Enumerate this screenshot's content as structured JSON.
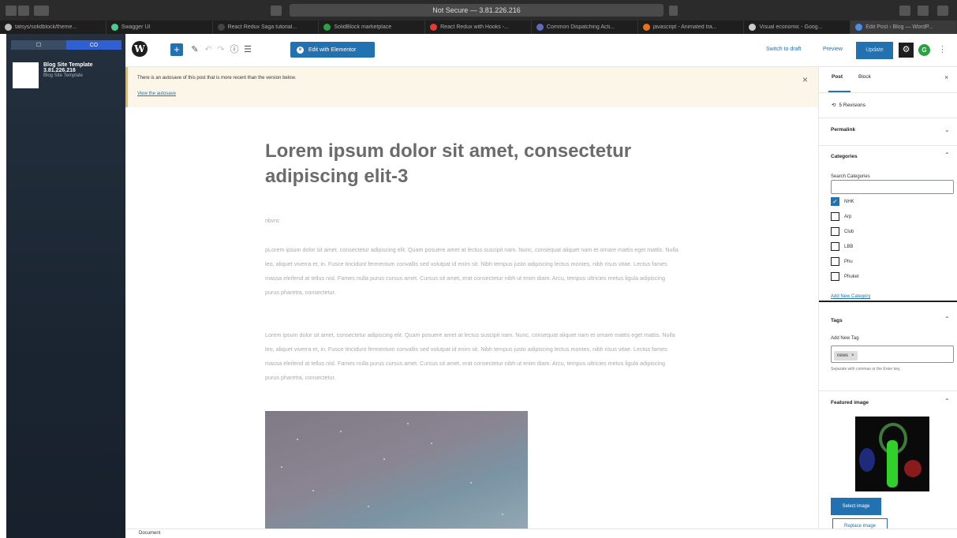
{
  "browser": {
    "url": "Not Secure — 3.81.226.216",
    "tabs": [
      {
        "label": "tatsys/solidblock/theme...",
        "color": "#bbbbbb"
      },
      {
        "label": "Swagger UI",
        "color": "#49cc90"
      },
      {
        "label": "React Redux Saga tutorial...",
        "color": "#444444"
      },
      {
        "label": "SolidBlock marketplace",
        "color": "#2ea043"
      },
      {
        "label": "React Redux with Hooks -...",
        "color": "#e53935"
      },
      {
        "label": "Common Dispatching Acti...",
        "color": "#5c6bc0"
      },
      {
        "label": "javascript - Animated tra...",
        "color": "#e8711a"
      },
      {
        "label": "Visual economic - Goog...",
        "color": "#cccccc"
      },
      {
        "label": "Edit Post ‹ Blog — WordP...",
        "color": "#4a8ee6"
      }
    ]
  },
  "left_sidebar": {
    "tab1": "☐",
    "tab2": "CO",
    "site": {
      "title": "Blog Site Template",
      "subtitle": "3.81.226.216",
      "meta": "Blog Site Template"
    }
  },
  "toolbar": {
    "logo": "W",
    "add_block": "+",
    "elementor_label": "Edit with Elementor",
    "switch_to_draft": "Switch to draft",
    "preview": "Preview",
    "update": "Update",
    "plugin_letter": "G"
  },
  "notice": {
    "text": "There is an autosave of this post that is more recent than the version below.",
    "link": "View the autosave"
  },
  "post": {
    "title": "Lorem ipsum dolor sit amet, consectetur adipiscing elit-3",
    "slug": "nbvnc",
    "paragraph1": "pLorem ipsum dolor sit amet, consectetur adipiscing elit. Quam posuere amet at lectus suscipit nam. Nunc, consequat aliquet nam et ornare mattis eget mattis. Nulla leo, aliquet viverra et, in. Fusce tincidunt fermentum convallis sed volutpat id enim sit. Nibh tempus justo adipiscing lectus montes, nibh risus vitae. Lectus fames massa eleifend at tellus nisl. Fames nulla purus cursus amet. Cursus sit amet, erat consectetur nibh ut enim diam. Arcu, tempus ultricies metus ligula adipiscing purus pharetra, consectetur.",
    "paragraph2": "Lorem ipsum dolor sit amet, consectetur adipiscing elit. Quam posuere amet at lectus suscipit nam. Nunc, consequat aliquet nam et ornare mattis eget mattis. Nulla leo, aliquet viverra et, in. Fusce tincidunt fermentum convallis sed volutpat id enim sit. Nibh tempus justo adipiscing lectus montes, nibh risus vitae. Lectus fames massa eleifend at tellus nisl. Fames nulla purus cursus amet. Cursus sit amet, erat consectetur nibh ut enim diam. Arcu, tempus ultricies metus ligula adipiscing purus pharetra, consectetur."
  },
  "footer": {
    "breadcrumb": "Document"
  },
  "settings_sidebar": {
    "tab_post": "Post",
    "tab_block": "Block",
    "close": "×",
    "revisions": "5 Revisions",
    "permalink": "Permalink",
    "categories": {
      "heading": "Categories",
      "search_label": "Search Categories",
      "search_value": "",
      "items": [
        {
          "label": "NHK",
          "checked": true
        },
        {
          "label": "Arp",
          "checked": false
        },
        {
          "label": "Club",
          "checked": false
        },
        {
          "label": "LBB",
          "checked": false
        },
        {
          "label": "Phu",
          "checked": false
        },
        {
          "label": "Phuket",
          "checked": false
        }
      ],
      "add_new": "Add New Category"
    },
    "tags": {
      "heading": "Tags",
      "add_label": "Add New Tag",
      "chip": "news",
      "help": "Separate with commas or the Enter key."
    },
    "featured": {
      "heading": "Featured image",
      "select": "Select image",
      "replace": "Replace image"
    }
  },
  "colors": {
    "accent": "#2271b1",
    "notice_bg": "#fcf6e9",
    "sidebar_bg": "#1b2532"
  }
}
